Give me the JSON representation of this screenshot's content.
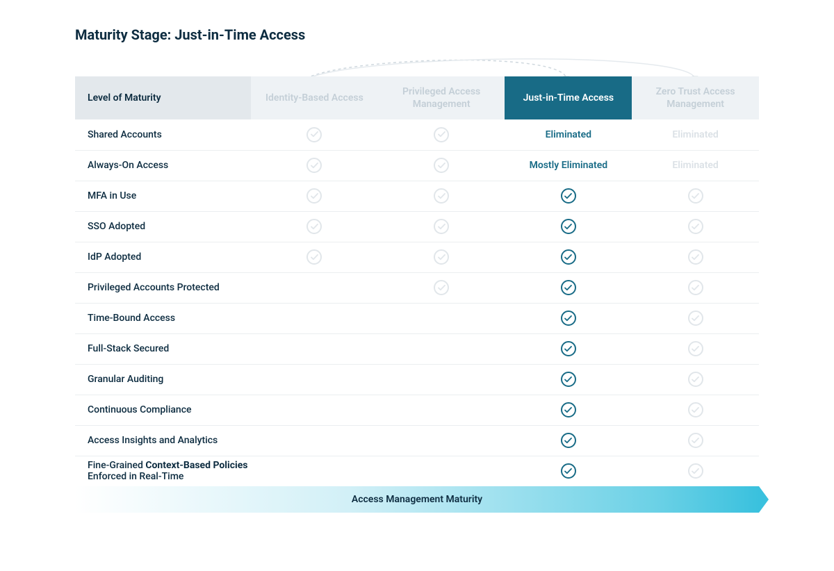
{
  "title": "Maturity Stage: Just-in-Time Access",
  "header": {
    "row_label": "Level of Maturity",
    "columns": [
      {
        "label": "Identity-Based Access",
        "active": false
      },
      {
        "label": "Privileged Access Management",
        "active": false
      },
      {
        "label": "Just-in-Time Access",
        "active": true
      },
      {
        "label": "Zero Trust Access Management",
        "active": false
      }
    ]
  },
  "rows": [
    {
      "label": "Shared Accounts",
      "cells": [
        "check-dim",
        "check-dim",
        "text-active:Eliminated",
        "text-dim:Eliminated"
      ]
    },
    {
      "label": "Always-On Access",
      "cells": [
        "check-dim",
        "check-dim",
        "text-active:Mostly Eliminated",
        "text-dim:Eliminated"
      ]
    },
    {
      "label": "MFA in Use",
      "cells": [
        "check-dim",
        "check-dim",
        "check-active",
        "check-dim"
      ]
    },
    {
      "label": "SSO Adopted",
      "cells": [
        "check-dim",
        "check-dim",
        "check-active",
        "check-dim"
      ]
    },
    {
      "label": "IdP Adopted",
      "cells": [
        "check-dim",
        "check-dim",
        "check-active",
        "check-dim"
      ]
    },
    {
      "label": "Privileged Accounts Protected",
      "cells": [
        "",
        "check-dim",
        "check-active",
        "check-dim"
      ]
    },
    {
      "label": "Time-Bound Access",
      "cells": [
        "",
        "",
        "check-active",
        "check-dim"
      ]
    },
    {
      "label": "Full-Stack Secured",
      "cells": [
        "",
        "",
        "check-active",
        "check-dim"
      ]
    },
    {
      "label": "Granular Auditing",
      "cells": [
        "",
        "",
        "check-active",
        "check-dim"
      ]
    },
    {
      "label": "Continuous Compliance",
      "cells": [
        "",
        "",
        "check-active",
        "check-dim"
      ]
    },
    {
      "label": "Access Insights and Analytics",
      "cells": [
        "",
        "",
        "check-active",
        "check-dim"
      ]
    },
    {
      "label_html": "Fine-Grained <b>Context-Based Policies</b> Enforced in Real-Time",
      "label": "Fine-Grained Context-Based Policies Enforced in Real-Time",
      "cells": [
        "",
        "",
        "check-active",
        "check-dim"
      ]
    }
  ],
  "footer_label": "Access Management Maturity"
}
